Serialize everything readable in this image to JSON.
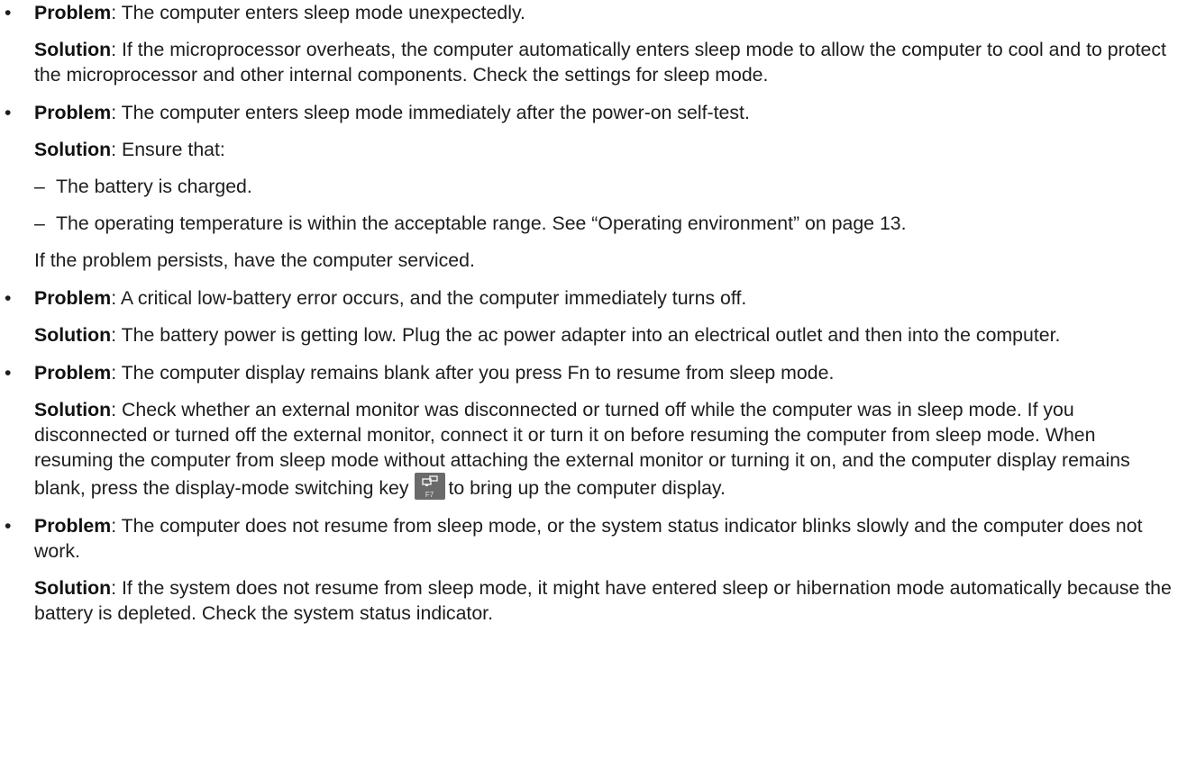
{
  "entries": [
    {
      "problem_label": "Problem",
      "problem_text": ": The computer enters sleep mode unexpectedly.",
      "solution_label": "Solution",
      "solution_text": ": If the microprocessor overheats, the computer automatically enters sleep mode to allow the computer to cool and to protect the microprocessor and other internal components. Check the settings for sleep mode."
    },
    {
      "problem_label": "Problem",
      "problem_text": ": The computer enters sleep mode immediately after the power-on self-test.",
      "solution_label": "Solution",
      "solution_text": ": Ensure that:",
      "subitems": [
        "The battery is charged.",
        "The operating temperature is within the acceptable range. See “Operating environment” on page 13."
      ],
      "followup": "If the problem persists, have the computer serviced."
    },
    {
      "problem_label": "Problem",
      "problem_text": ": A critical low-battery error occurs, and the computer immediately turns off.",
      "solution_label": "Solution",
      "solution_text": ": The battery power is getting low. Plug the ac power adapter into an electrical outlet and then into the computer."
    },
    {
      "problem_label": "Problem",
      "problem_text": ": The computer display remains blank after you press Fn to resume from sleep mode.",
      "solution_label": "Solution",
      "solution_text_before_key": ": Check whether an external monitor was disconnected or turned off while the computer was in sleep mode. If you disconnected or turned off the external monitor, connect it or turn it on before resuming the computer from sleep mode. When resuming the computer from sleep mode without attaching the external monitor or turning it on, and the computer display remains blank, press the display-mode switching key",
      "key_label": "F7",
      "key_icon": "display-mode-icon",
      "solution_text_after_key": "to bring up the computer display."
    },
    {
      "problem_label": "Problem",
      "problem_text": ": The computer does not resume from sleep mode, or the system status indicator blinks slowly and the computer does not work.",
      "solution_label": "Solution",
      "solution_text": ": If the system does not resume from sleep mode, it might have entered sleep or hibernation mode automatically because the battery is depleted. Check the system status indicator."
    }
  ]
}
